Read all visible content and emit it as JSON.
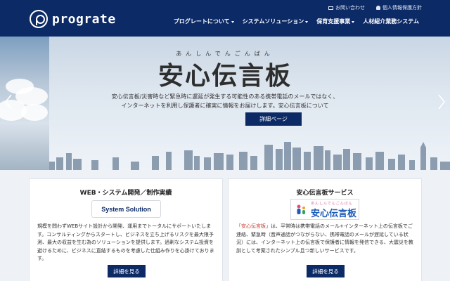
{
  "header": {
    "logo_text": "prograte",
    "util_links": [
      "お問い合わせ",
      "個人情報保護方針"
    ],
    "nav": [
      {
        "label": "プログレートについて",
        "dropdown": true
      },
      {
        "label": "システムソリューション",
        "dropdown": true
      },
      {
        "label": "保育支援事業",
        "dropdown": true
      },
      {
        "label": "人材紹介業務システム",
        "dropdown": false
      }
    ]
  },
  "hero": {
    "ruby": "あんしんでんごんばん",
    "title": "安心伝言板",
    "desc_line1": "安心伝言板/災害時など緊急時に遅延が発生する可能性のある携帯電話のメールではなく、",
    "desc_line2": "インターネットを利用し保護者に確実に情報をお届けします。安心伝言板について",
    "button": "詳細ページ"
  },
  "cards": {
    "left": {
      "title": "WEB・システム開発／制作実績",
      "logo_text": "System Solution",
      "body": "規模を問わずWEBサイト設計から開発、運用までトータルにサポートいたします。コンサルティングからスタートし、ビジネスを立ち上げるリスクを最大限予測、最大の収益を生む為のソリューションを提供します。過剰なシステム投資を避けるために、ビジネスに直結するものを考慮した仕組み作りを心掛けております。",
      "button": "詳細を見る"
    },
    "right": {
      "title": "安心伝言板サービス",
      "logo_ruby": "あんしんでんごんばん",
      "logo_text": "安心伝言板",
      "body_highlight": "「安心伝言板」",
      "body": "は、平常時は携帯電話のメール+インターネット上の伝言板でご連絡、緊急時（音声通話がつながらない、携帯電話のメールが遅延している状況）には、インターネット上の伝言板で保護者に情報を発信できる、大震災を教訓として考案されたシンプル且つ新しいサービスです。",
      "button": "詳細を見る"
    }
  },
  "colors": {
    "primary": "#0c2a66",
    "highlight": "#c0392b"
  }
}
